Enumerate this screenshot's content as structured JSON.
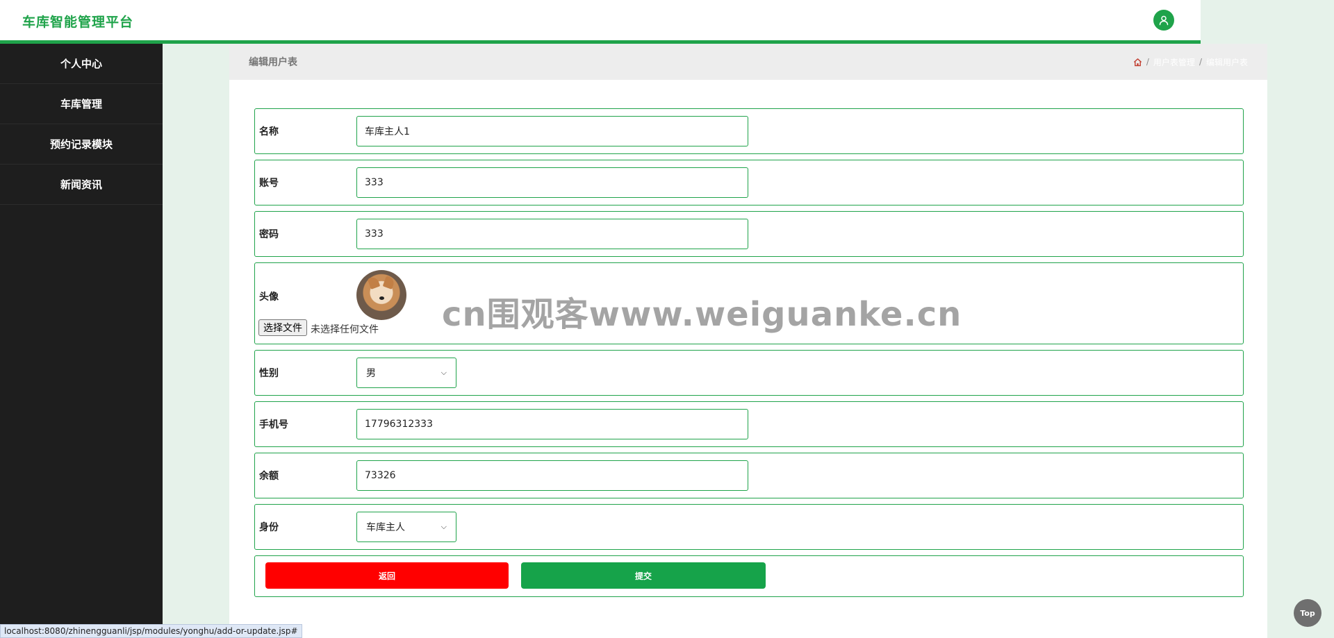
{
  "header": {
    "brand": "车库智能管理平台",
    "user_icon": "user-icon"
  },
  "sidebar": {
    "items": [
      {
        "label": "个人中心"
      },
      {
        "label": "车库管理"
      },
      {
        "label": "预约记录模块"
      },
      {
        "label": "新闻资讯"
      }
    ]
  },
  "panel": {
    "title": "编辑用户表",
    "breadcrumb": {
      "home_icon": "home-icon",
      "items": [
        "用户表管理",
        "编辑用户表"
      ],
      "separator": "/"
    }
  },
  "form": {
    "name": {
      "label": "名称",
      "value": "车库主人1"
    },
    "account": {
      "label": "账号",
      "value": "333"
    },
    "password": {
      "label": "密码",
      "value": "333"
    },
    "avatar": {
      "label": "头像",
      "file_button": "选择文件",
      "file_status": "未选择任何文件"
    },
    "gender": {
      "label": "性别",
      "value": "男"
    },
    "phone": {
      "label": "手机号",
      "value": "17796312333"
    },
    "balance": {
      "label": "余额",
      "value": "73326"
    },
    "role": {
      "label": "身份",
      "value": "车库主人"
    },
    "back_button": "返回",
    "submit_button": "提交"
  },
  "watermark": "cn围观客www.weiguanke.cn",
  "status_bar": {
    "url": "localhost:8080/zhinengguanli/jsp/modules/yonghu/add-or-update.jsp#"
  },
  "top_button": "Top",
  "colors": {
    "brand": "#1fa34a",
    "sidebar_bg": "#1e1e1e",
    "back_button": "#ff0000",
    "submit_button": "#16a34a",
    "breadcrumb_home": "#c0392b"
  }
}
